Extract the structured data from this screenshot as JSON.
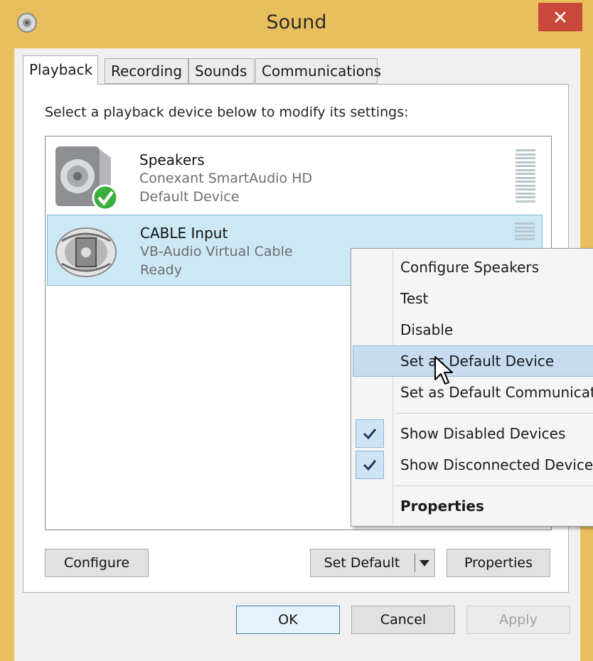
{
  "window": {
    "title": "Sound",
    "close_icon": "close-icon"
  },
  "tabs": [
    {
      "label": "Playback",
      "active": true
    },
    {
      "label": "Recording",
      "active": false
    },
    {
      "label": "Sounds",
      "active": false
    },
    {
      "label": "Communications",
      "active": false
    }
  ],
  "instruction": "Select a playback device below to modify its settings:",
  "devices": [
    {
      "name": "Speakers",
      "driver": "Conexant SmartAudio HD",
      "status": "Default Device",
      "icon": "speaker-icon",
      "selected": false
    },
    {
      "name": "CABLE Input",
      "driver": "VB-Audio Virtual Cable",
      "status": "Ready",
      "icon": "cable-icon",
      "selected": true
    }
  ],
  "context_menu": {
    "items": [
      {
        "label": "Configure Speakers"
      },
      {
        "label": "Test"
      },
      {
        "label": "Disable"
      },
      {
        "label": "Set as Default Device",
        "hover": true
      },
      {
        "label": "Set as Default Communications Device"
      },
      {
        "label": "Show Disabled Devices",
        "checked": true
      },
      {
        "label": "Show Disconnected Devices",
        "checked": true
      },
      {
        "label": "Properties",
        "bold": true
      }
    ]
  },
  "panel_buttons": {
    "configure": "Configure",
    "set_default": "Set Default",
    "properties": "Properties"
  },
  "dialog_buttons": {
    "ok": "OK",
    "cancel": "Cancel",
    "apply": "Apply"
  },
  "colors": {
    "title_bar": "#e8bf5c",
    "close": "#c9473b",
    "selection": "#cce8f4",
    "menu_hover": "#c7dcef"
  }
}
